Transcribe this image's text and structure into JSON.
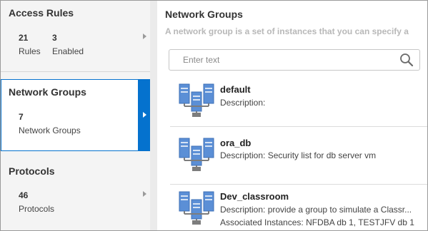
{
  "sidebar": {
    "cards": [
      {
        "title": "Access Rules",
        "stats": [
          {
            "value": "21",
            "label": "Rules"
          },
          {
            "value": "3",
            "label": "Enabled"
          }
        ]
      },
      {
        "title": "Network Groups",
        "stats": [
          {
            "value": "7",
            "label": "Network Groups"
          }
        ]
      },
      {
        "title": "Protocols",
        "stats": [
          {
            "value": "46",
            "label": "Protocols"
          }
        ]
      }
    ]
  },
  "main": {
    "title": "Network Groups",
    "subtitle": "A network group is a set of instances that you can specify a",
    "search": {
      "placeholder": "Enter text",
      "value": ""
    },
    "items": [
      {
        "name": "default",
        "description": "Description:",
        "associated": ""
      },
      {
        "name": "ora_db",
        "description": "Description: Security list for db server vm",
        "associated": ""
      },
      {
        "name": "Dev_classroom",
        "description": "Description: provide a group to simulate a Classr...",
        "associated": "Associated Instances: NFDBA db 1, TESTJFV db 1"
      }
    ]
  },
  "colors": {
    "selected_accent": "#0572ce",
    "icon_blue": "#5b8fd6",
    "icon_gray": "#7d7d7d"
  }
}
